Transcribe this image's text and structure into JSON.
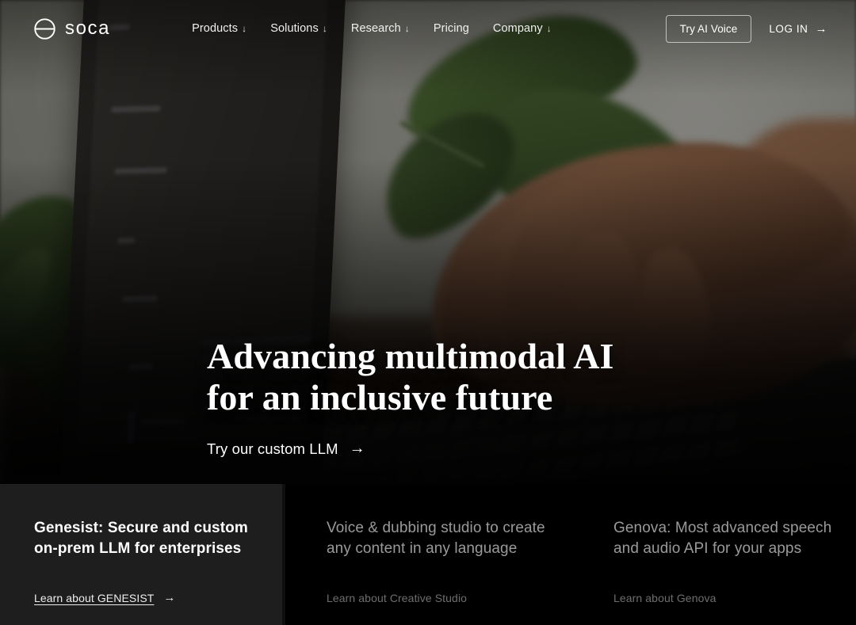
{
  "brand": {
    "name": "soca",
    "logo_icon": "circle-bisected-logo-icon"
  },
  "nav": {
    "links": [
      {
        "label": "Products",
        "caret": "↓"
      },
      {
        "label": "Solutions",
        "caret": "↓"
      },
      {
        "label": "Research",
        "caret": "↓"
      },
      {
        "label": "Pricing",
        "caret": ""
      },
      {
        "label": "Company",
        "caret": "↓"
      }
    ],
    "try_button": "Try AI Voice",
    "login_label": "LOG IN",
    "login_arrow": "→"
  },
  "hero": {
    "headline_line1": "Advancing multimodal AI",
    "headline_line2": "for an inclusive future",
    "cta_label": "Try our custom LLM",
    "cta_arrow": "→"
  },
  "cards": [
    {
      "title": "Genesist: Secure and custom on-prem LLM for enterprises",
      "link_label": "Learn about GENESIST",
      "link_arrow": "→"
    },
    {
      "title": "Voice & dubbing studio to create any content in any language",
      "link_label": "Learn about Creative Studio",
      "link_arrow": ""
    },
    {
      "title": "Genova: Most advanced speech and audio API for your apps",
      "link_label": "Learn about Genova",
      "link_arrow": ""
    }
  ],
  "colors": {
    "active_card_bg": "#1e1e1e",
    "inactive_card_bg": "#000000",
    "text_primary": "#ffffff",
    "text_muted": "#9a9a9a",
    "link_muted": "#6e6e6e"
  }
}
